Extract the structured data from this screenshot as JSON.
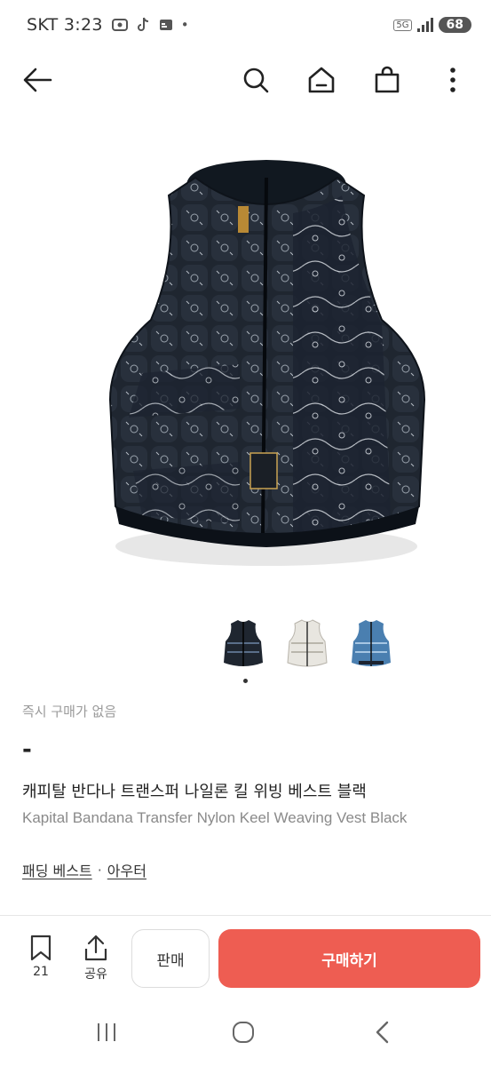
{
  "status_bar": {
    "carrier": "SKT",
    "time": "3:23",
    "network": "5G",
    "battery": "68"
  },
  "product": {
    "instant_buy_text": "즉시 구매가 없음",
    "price": "-",
    "title_ko": "캐피탈 반다나 트랜스퍼 나일론 킬 위빙 베스트 블랙",
    "title_en": "Kapital Bandana Transfer Nylon Keel Weaving Vest Black",
    "categories": [
      "패딩 베스트",
      "아우터"
    ],
    "category_separator": "·",
    "image_count": 3,
    "selected_image_index": 0
  },
  "action_bar": {
    "bookmark_count": "21",
    "share_label": "공유",
    "sell_label": "판매",
    "buy_label": "구매하기"
  },
  "colors": {
    "accent": "#ee5d52",
    "vest_black": "#1f2630",
    "vest_white": "#e8e6e0",
    "vest_blue": "#4a7fb0"
  },
  "icons": [
    "back-arrow-icon",
    "search-icon",
    "home-icon",
    "shopping-bag-icon",
    "more-vertical-icon",
    "bookmark-icon",
    "share-icon",
    "recent-apps-icon",
    "home-circle-icon",
    "back-chevron-icon"
  ]
}
